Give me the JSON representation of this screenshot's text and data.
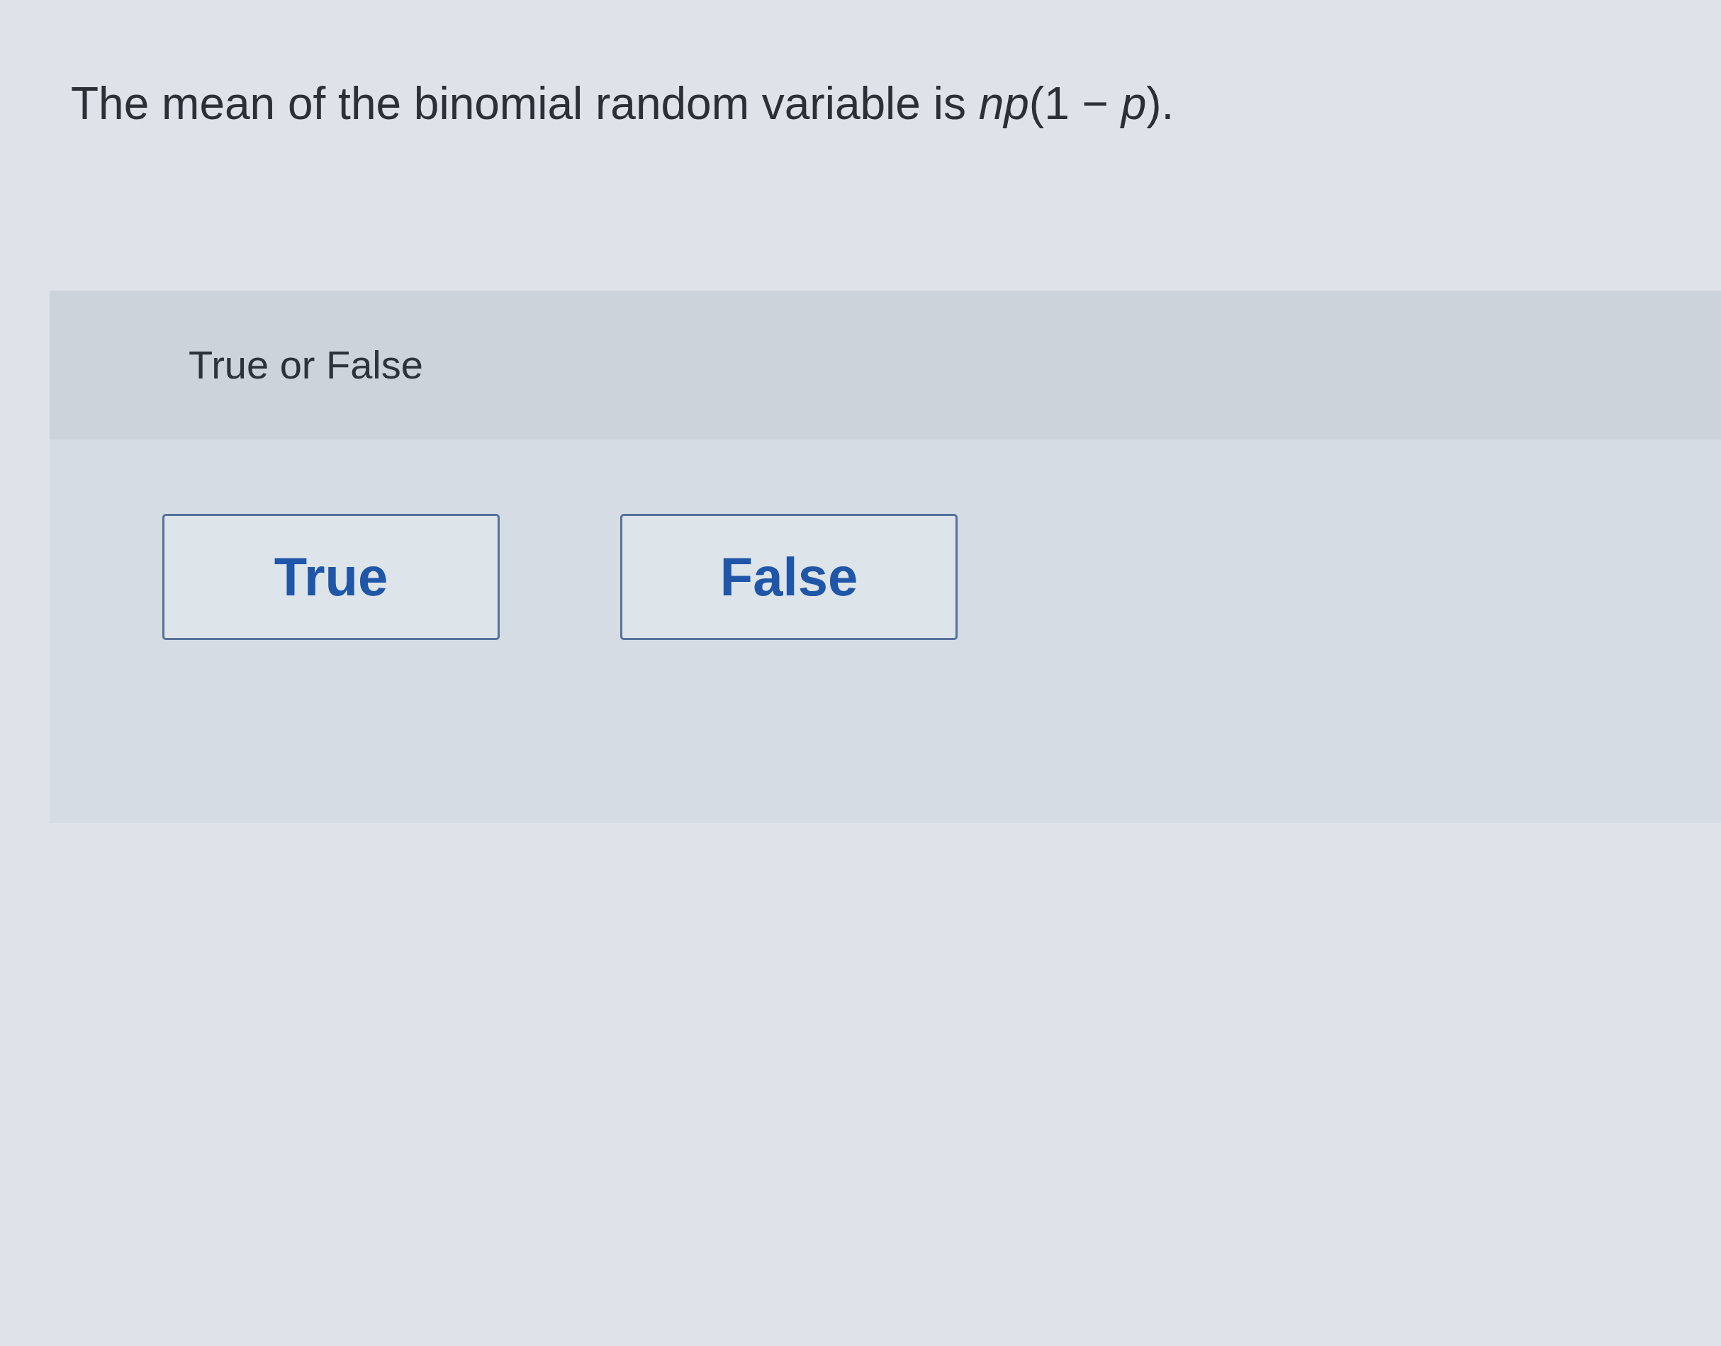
{
  "question": "The mean of the binomial random variable is *np*(1 − *p*).",
  "prompt": "True or False",
  "options": [
    {
      "label": "True",
      "selected": false
    },
    {
      "label": "False",
      "selected": false
    }
  ]
}
